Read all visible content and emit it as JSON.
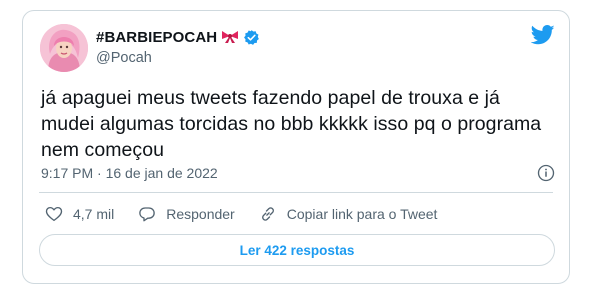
{
  "tweet": {
    "display_name": "#BARBIEPOCAH",
    "handle": "@Pocah",
    "text": "já apaguei meus tweets fazendo papel de trouxa e já\nmudei algumas torcidas no bbb kkkkk isso pq o programa\nnem começou",
    "timestamp": "9:17 PM · 16 de jan de 2022",
    "likes": "4,7 mil",
    "reply_label": "Responder",
    "copy_link_label": "Copiar link para o Tweet",
    "read_replies_label": "Ler 422 respostas"
  },
  "icons": {
    "bow": "ribbon-bow-icon",
    "verified": "verified-badge-icon",
    "brand": "twitter-bird-icon",
    "info": "info-icon",
    "like": "heart-icon",
    "reply": "speech-bubble-icon",
    "link": "link-icon"
  },
  "colors": {
    "accent": "#1d9bf0",
    "text": "#0f1419",
    "muted": "#536471",
    "border": "#cfd9de",
    "bow": "#e0245e"
  }
}
